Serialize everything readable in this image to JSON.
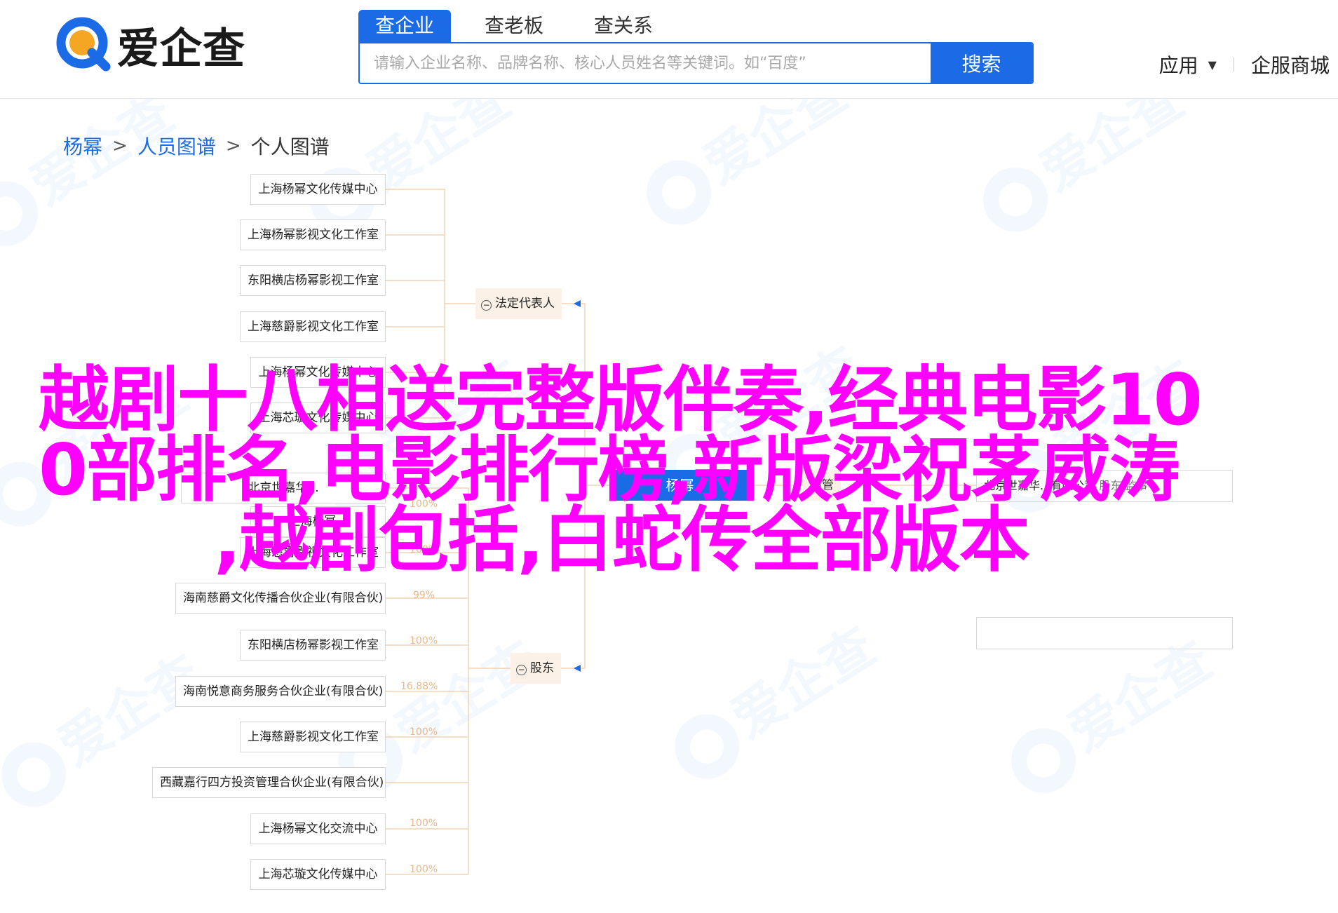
{
  "brand": {
    "name": "爱企查",
    "accent": "#1c6be6",
    "accent2": "#f5a623"
  },
  "search": {
    "tabs": [
      "查企业",
      "查老板",
      "查关系"
    ],
    "active_tab": "查企业",
    "placeholder": "请输入企业名称、品牌名称、核心人员姓名等关键词。如“百度”",
    "button": "搜索"
  },
  "header_right": {
    "apps": "应用",
    "service": "企服商城"
  },
  "breadcrumb": {
    "items": [
      "杨幂",
      "人员图谱"
    ],
    "current": "个人图谱"
  },
  "chart_hubs": {
    "legal": "法定代表人",
    "shareholder": "股东"
  },
  "legal_rep_companies": [
    "上海杨幂文化传媒中心",
    "上海杨幂影视文化工作室",
    "东阳横店杨幂影视工作室",
    "上海慈爵影视文化工作室",
    "上海杨幂文化传媒中心",
    "上海芯璇文化传媒中心"
  ],
  "shareholder_companies": [
    {
      "name": "北京世嘉华...",
      "pct": ""
    },
    {
      "name": "上海杨幂...",
      "pct": "100%"
    },
    {
      "name": "上海慈爵影视文化工作室",
      "pct": "100%"
    },
    {
      "name": "海南慈爵文化传播合伙企业(有限合伙)",
      "pct": "99%"
    },
    {
      "name": "东阳横店杨幂影视工作室",
      "pct": "100%"
    },
    {
      "name": "海南悦意商务服务合伙企业(有限合伙)",
      "pct": "16.88%"
    },
    {
      "name": "上海慈爵影视文化工作室",
      "pct": "100%"
    },
    {
      "name": "西藏嘉行四方投资管理合伙企业(有限合伙)",
      "pct": ""
    },
    {
      "name": "上海杨幂文化交流中心",
      "pct": "100%"
    },
    {
      "name": "上海芯璇文化传媒中心",
      "pct": "100%"
    }
  ],
  "right_side": {
    "hub": "高管",
    "company": "北京世嘉华...有限公司",
    "role": "股东,监事",
    "center_fragment": "杨幂"
  },
  "overlay_text": {
    "line1": "越剧十八相送完整版伴奏,经典电影10",
    "line2": "0部排名,电影排行榜,新版梁祝茅威涛",
    "line3": ",越剧包括,白蛇传全部版本"
  },
  "watermark": "爱企查"
}
